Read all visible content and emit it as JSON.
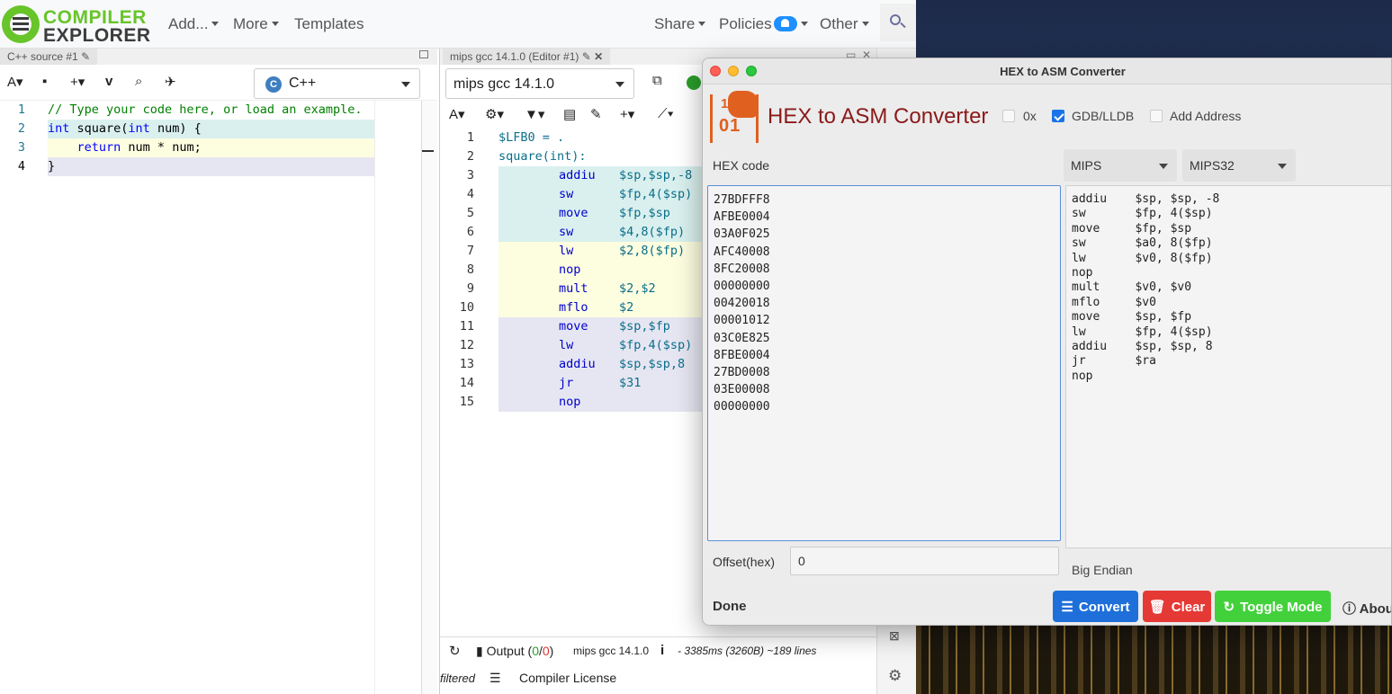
{
  "app": {
    "logo_line1": "COMPILER",
    "logo_line2": "EXPLORER",
    "nav": {
      "add": "Add...",
      "more": "More",
      "templates": "Templates",
      "share": "Share",
      "policies": "Policies",
      "other": "Other"
    }
  },
  "source_panel": {
    "tab_title": "C++ source #1",
    "language": "C++",
    "lines": [
      {
        "n": "1",
        "parts": [
          {
            "t": "// Type your code here, or load an example.",
            "c": "c-cm"
          }
        ]
      },
      {
        "n": "2",
        "parts": [
          {
            "t": "int",
            "c": "c-kw"
          },
          {
            "t": " square(",
            "c": "c-tx"
          },
          {
            "t": "int",
            "c": "c-kw"
          },
          {
            "t": " num) {",
            "c": "c-tx"
          }
        ]
      },
      {
        "n": "3",
        "parts": [
          {
            "t": "    ",
            "c": "c-tx"
          },
          {
            "t": "return",
            "c": "c-kw"
          },
          {
            "t": " num * num;",
            "c": "c-tx"
          }
        ]
      },
      {
        "n": "4",
        "parts": [
          {
            "t": "}",
            "c": "c-tx"
          }
        ]
      }
    ]
  },
  "asm_panel": {
    "tab_title": "mips gcc 14.1.0 (Editor #1)",
    "compiler": "mips gcc 14.1.0",
    "lines": [
      {
        "n": "1",
        "label": "$LFB0 = .",
        "op": "",
        "args": ""
      },
      {
        "n": "2",
        "label": "square(int):",
        "op": "",
        "args": ""
      },
      {
        "n": "3",
        "label": "",
        "op": "addiu",
        "args": "$sp,$sp,-8"
      },
      {
        "n": "4",
        "label": "",
        "op": "sw",
        "args": "$fp,4($sp)"
      },
      {
        "n": "5",
        "label": "",
        "op": "move",
        "args": "$fp,$sp"
      },
      {
        "n": "6",
        "label": "",
        "op": "sw",
        "args": "$4,8($fp)"
      },
      {
        "n": "7",
        "label": "",
        "op": "lw",
        "args": "$2,8($fp)"
      },
      {
        "n": "8",
        "label": "",
        "op": "nop",
        "args": ""
      },
      {
        "n": "9",
        "label": "",
        "op": "mult",
        "args": "$2,$2"
      },
      {
        "n": "10",
        "label": "",
        "op": "mflo",
        "args": "$2"
      },
      {
        "n": "11",
        "label": "",
        "op": "move",
        "args": "$sp,$fp"
      },
      {
        "n": "12",
        "label": "",
        "op": "lw",
        "args": "$fp,4($sp)"
      },
      {
        "n": "13",
        "label": "",
        "op": "addiu",
        "args": "$sp,$sp,8"
      },
      {
        "n": "14",
        "label": "",
        "op": "jr",
        "args": "$31"
      },
      {
        "n": "15",
        "label": "",
        "op": "nop",
        "args": ""
      }
    ],
    "output_label": "Output (",
    "output_ok": "0",
    "output_sep": "/",
    "output_err": "0",
    "output_close": ")",
    "compiler_short": "mips gcc 14.1.0",
    "stats": "- 3385ms (3260B) ~189 lines",
    "filtered": "filtered",
    "license": "Compiler License"
  },
  "hex_dialog": {
    "window_title": "HEX to ASM Converter",
    "heading": "HEX to ASM Converter",
    "opt_0x": "0x",
    "opt_gdb": "GDB/LLDB",
    "opt_addr": "Add Address",
    "hex_label": "HEX code",
    "arch": "MIPS",
    "mode": "MIPS32",
    "hex_code": "27BDFFF8\nAFBE0004\n03A0F025\nAFC40008\n8FC20008\n00000000\n00420018\n00001012\n03C0E825\n8FBE0004\n27BD0008\n03E00008\n00000000",
    "asm_output": "addiu    $sp, $sp, -8\nsw       $fp, 4($sp)\nmove     $fp, $sp\nsw       $a0, 8($fp)\nlw       $v0, 8($fp)\nnop\nmult     $v0, $v0\nmflo     $v0\nmove     $sp, $fp\nlw       $fp, 4($sp)\naddiu    $sp, $sp, 8\njr       $ra\nnop",
    "offset_label": "Offset(hex)",
    "offset_value": "0",
    "endian": "Big Endian",
    "done": "Done",
    "convert": "Convert",
    "clear": "Clear",
    "toggle": "Toggle Mode",
    "about": "About"
  },
  "colors": {
    "ce_green": "#67c52a",
    "convert_blue": "#1e6fd9",
    "clear_red": "#e53935",
    "toggle_green": "#43d13b",
    "heading_red": "#8b1a1a"
  }
}
